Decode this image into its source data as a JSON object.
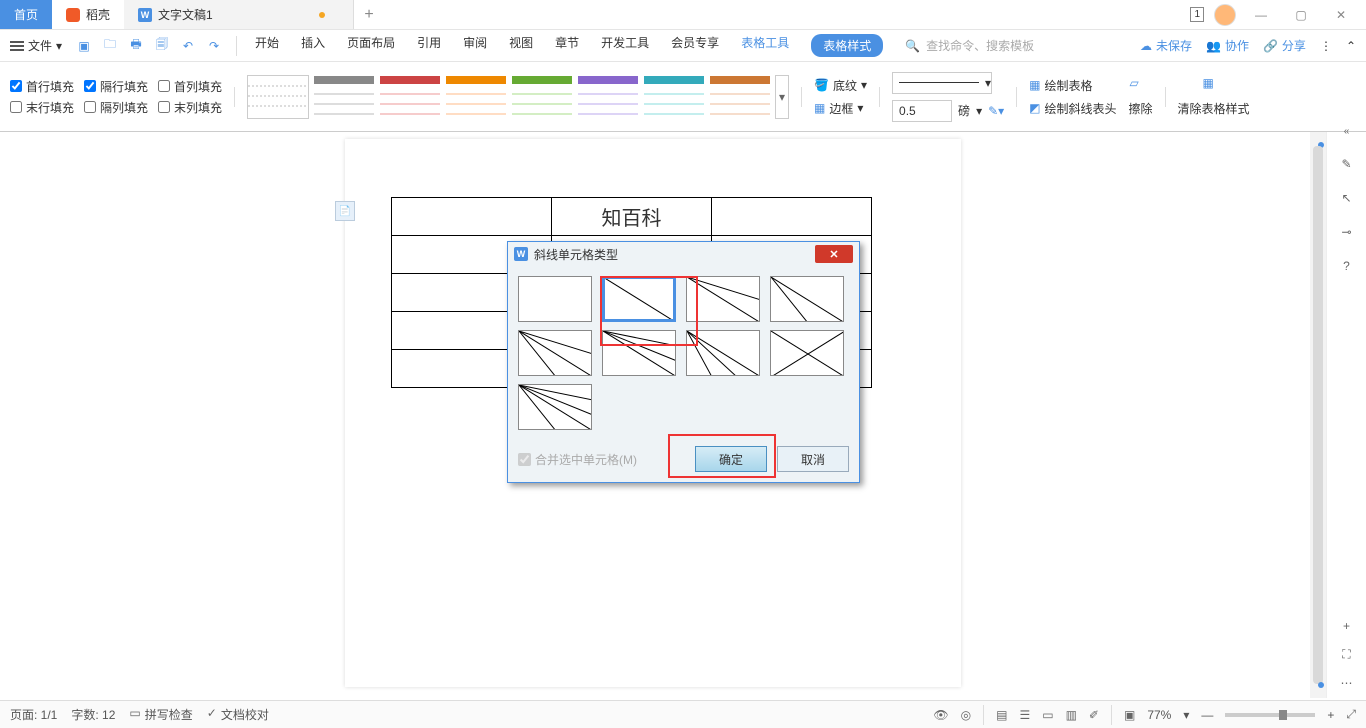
{
  "titlebar": {
    "home": "首页",
    "docer": "稻壳",
    "doc_name": "文字文稿1",
    "badge": "1"
  },
  "menubar": {
    "file": "文件",
    "tabs": [
      "开始",
      "插入",
      "页面布局",
      "引用",
      "审阅",
      "视图",
      "章节",
      "开发工具",
      "会员专享"
    ],
    "table_tools": "表格工具",
    "table_style": "表格样式",
    "search_placeholder": "查找命令、搜索模板",
    "unsaved": "未保存",
    "collab": "协作",
    "share": "分享"
  },
  "ribbon": {
    "fills": [
      "首行填充",
      "隔行填充",
      "首列填充",
      "末行填充",
      "隔列填充",
      "末列填充"
    ],
    "fill_checked": [
      true,
      true,
      false,
      false,
      false,
      false
    ],
    "shading": "底纹",
    "border": "边框",
    "weight": "0.5",
    "unit": "磅",
    "draw_table": "绘制表格",
    "draw_diag": "绘制斜线表头",
    "eraser": "擦除",
    "clear_style": "清除表格样式"
  },
  "document": {
    "table_text": "知百科"
  },
  "dialog": {
    "title": "斜线单元格类型",
    "merge": "合并选中单元格(M)",
    "ok": "确定",
    "cancel": "取消"
  },
  "status": {
    "page": "页面: 1/1",
    "words": "字数: 12",
    "spell": "拼写检查",
    "proof": "文档校对",
    "zoom": "77%"
  }
}
